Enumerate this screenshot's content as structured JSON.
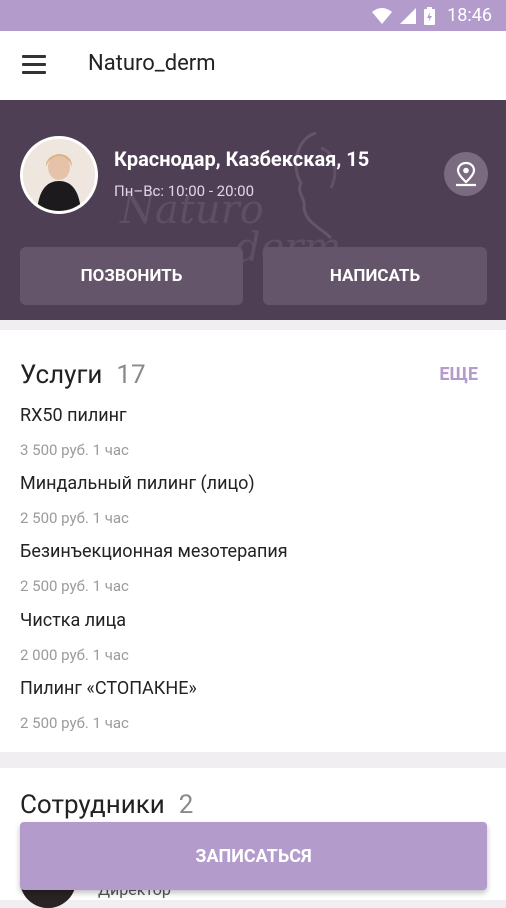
{
  "status_bar": {
    "time": "18:46"
  },
  "toolbar": {
    "title": "Naturo_derm"
  },
  "hero": {
    "watermark_line1": "Naturo",
    "watermark_line2": "derm",
    "address": "Краснодар, Казбекская, 15",
    "hours": "Пн–Вс: 10:00 - 20:00",
    "call_label": "ПОЗВОНИТЬ",
    "message_label": "НАПИСАТЬ"
  },
  "services": {
    "title": "Услуги",
    "count": "17",
    "more_label": "ЕЩЕ",
    "items": [
      {
        "name": "RX50 пилинг",
        "meta": "3 500 руб.   1 час"
      },
      {
        "name": "Миндальный пилинг (лицо)",
        "meta": "2 500 руб.   1 час"
      },
      {
        "name": "Безинъекционная мезотерапия",
        "meta": "2 500 руб.   1 час"
      },
      {
        "name": "Чистка лица",
        "meta": "2 000 руб.   1 час"
      },
      {
        "name": "Пилинг «СТОПАКНЕ»",
        "meta": "2 500 руб.   1 час"
      }
    ]
  },
  "staff": {
    "title": "Сотрудники",
    "count": "2",
    "role": "Директор"
  },
  "book_label": "ЗАПИСАТЬСЯ"
}
